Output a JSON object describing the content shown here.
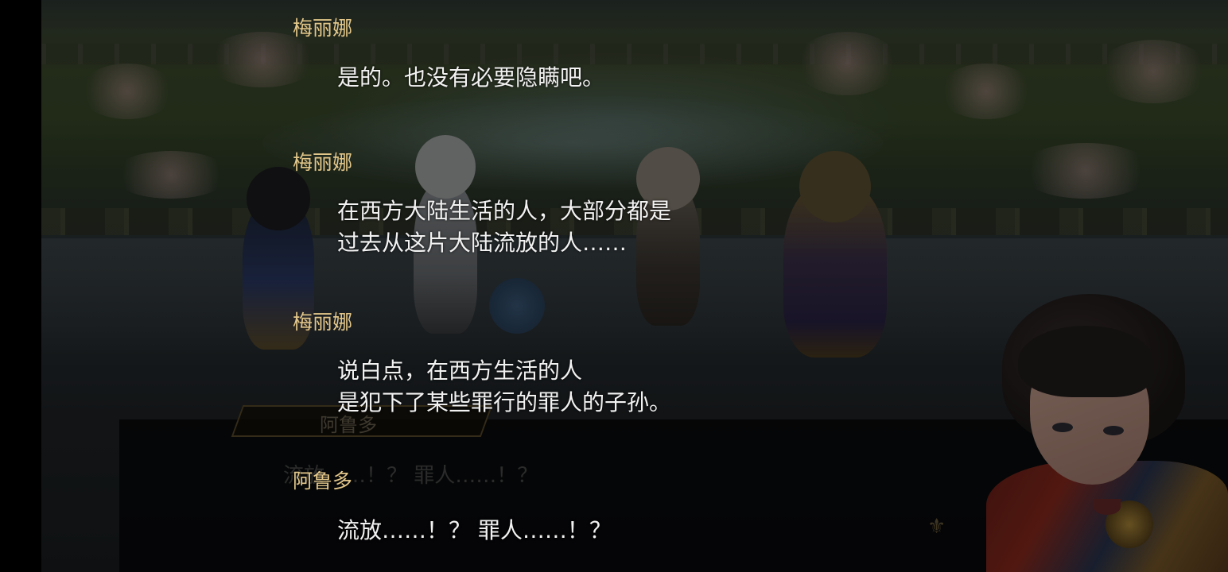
{
  "background": {
    "nameplate_text": "阿鲁多",
    "message_text": "流放……！？ 罪人……！？"
  },
  "backlog": {
    "entries": [
      {
        "speaker": "梅丽娜",
        "lines": [
          "是的。也没有必要隐瞒吧。"
        ]
      },
      {
        "speaker": "梅丽娜",
        "lines": [
          "在西方大陆生活的人，大部分都是",
          "过去从这片大陆流放的人……"
        ]
      },
      {
        "speaker": "梅丽娜",
        "lines": [
          "说白点，在西方生活的人",
          "是犯下了某些罪行的罪人的子孙。"
        ]
      },
      {
        "speaker": "阿鲁多",
        "lines": [
          "流放……！？ 罪人……！？"
        ]
      }
    ]
  },
  "colors": {
    "speaker_name": "#e3c78a",
    "dialogue_text": "#f2f2f2"
  },
  "icons": {
    "crest": "crest-icon"
  }
}
